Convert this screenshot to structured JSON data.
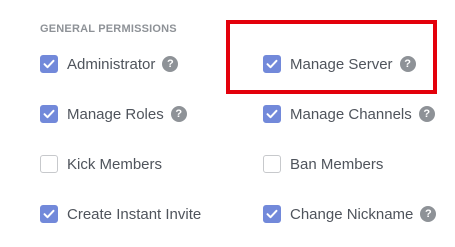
{
  "section": {
    "title": "GENERAL PERMISSIONS"
  },
  "help_icon_glyph": "?",
  "colors": {
    "checkbox_checked": "#7289da",
    "label_text": "#4f545c",
    "highlight_border": "#e3000b",
    "help_icon": "#8e9297"
  },
  "permissions": [
    {
      "label": "Administrator",
      "checked": true,
      "has_help": true
    },
    {
      "label": "Manage Server",
      "checked": true,
      "has_help": true,
      "highlighted": true
    },
    {
      "label": "Manage Roles",
      "checked": true,
      "has_help": true
    },
    {
      "label": "Manage Channels",
      "checked": true,
      "has_help": true
    },
    {
      "label": "Kick Members",
      "checked": false,
      "has_help": false
    },
    {
      "label": "Ban Members",
      "checked": false,
      "has_help": false
    },
    {
      "label": "Create Instant Invite",
      "checked": true,
      "has_help": false
    },
    {
      "label": "Change Nickname",
      "checked": true,
      "has_help": true
    }
  ]
}
